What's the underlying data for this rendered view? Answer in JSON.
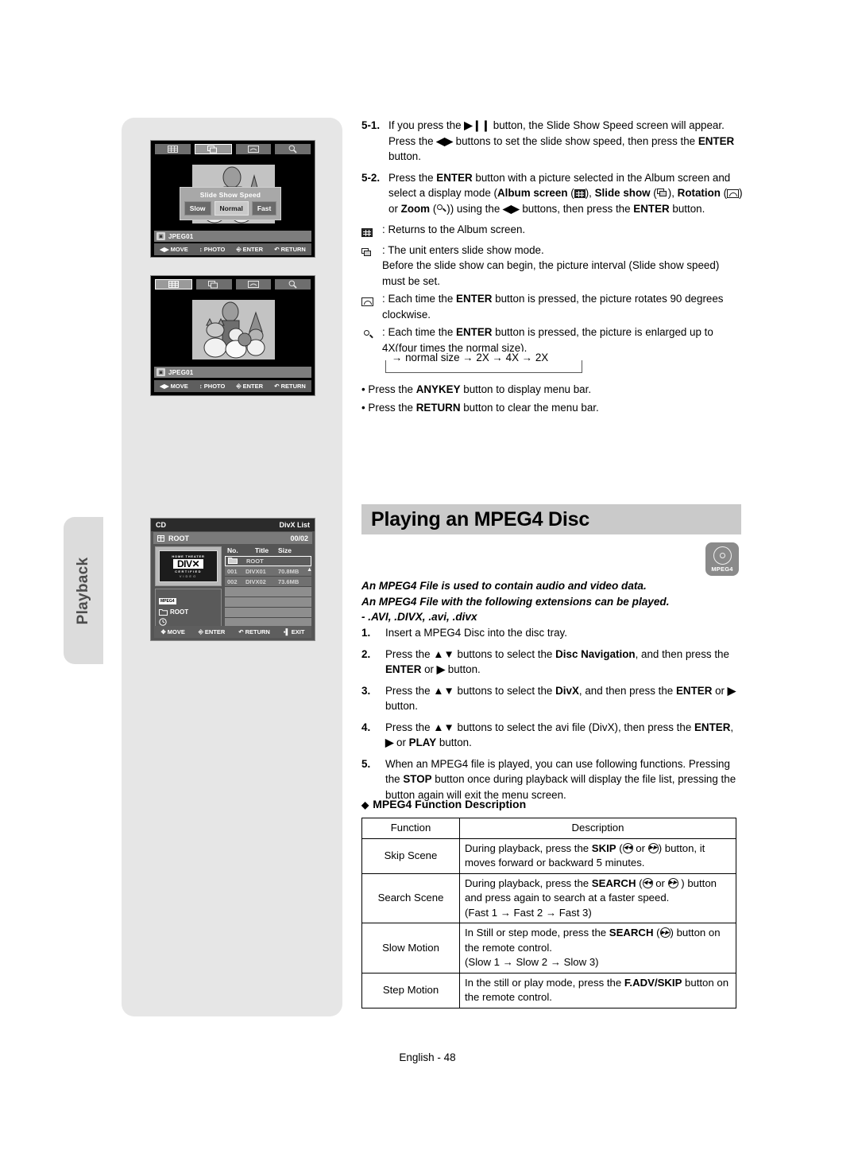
{
  "sidebar": {
    "tab_label": "Playback"
  },
  "screens": {
    "slideshow": {
      "toolbar": [
        "album-screen-icon",
        "slide-show-icon",
        "rotation-icon",
        "zoom-icon"
      ],
      "selected_tool": "slide-show-icon",
      "dialog": {
        "title": "Slide Show Speed",
        "options": [
          "Slow",
          "Normal",
          "Fast"
        ],
        "selected": "Normal"
      },
      "file_label": "JPEG01",
      "hints": [
        {
          "key": "◀▶",
          "label": "MOVE"
        },
        {
          "key": "↕",
          "label": "PHOTO"
        },
        {
          "key": "⓪",
          "label": "ENTER"
        },
        {
          "key": "↶",
          "label": "RETURN"
        }
      ]
    },
    "album": {
      "toolbar": [
        "album-screen-icon",
        "slide-show-icon",
        "rotation-icon",
        "zoom-icon"
      ],
      "selected_tool": "album-screen-icon",
      "file_label": "JPEG01",
      "hints": [
        {
          "key": "◀▶",
          "label": "MOVE"
        },
        {
          "key": "↕",
          "label": "PHOTO"
        },
        {
          "key": "⓪",
          "label": "ENTER"
        },
        {
          "key": "↶",
          "label": "RETURN"
        }
      ]
    },
    "divx_list": {
      "disc_label": "CD",
      "mode_label": "DivX List",
      "folder": "ROOT",
      "counter": "00/02",
      "logo": {
        "top_text": "HOME THEATER",
        "brand": "DIV✕",
        "certified": "CERTIFIED",
        "video": "VIDEO"
      },
      "tree": {
        "tag": "MPEG4",
        "root": "ROOT"
      },
      "columns": [
        "No.",
        "Title",
        "Size"
      ],
      "rows": [
        {
          "no": "",
          "title": "ROOT",
          "size": "",
          "selected": true,
          "folder": true
        },
        {
          "no": "001",
          "title": "DIVX01",
          "size": "70.8MB",
          "selected": false,
          "folder": false
        },
        {
          "no": "002",
          "title": "DIVX02",
          "size": "73.6MB",
          "selected": false,
          "folder": false
        }
      ],
      "empty_rows": 5,
      "hints": [
        {
          "key": "✥",
          "label": "MOVE"
        },
        {
          "key": "⓪",
          "label": "ENTER"
        },
        {
          "key": "↶",
          "label": "RETURN"
        },
        {
          "key": "▮",
          "label": "EXIT"
        }
      ]
    }
  },
  "steps_top": [
    {
      "num": "5-1.",
      "html": "If you press the <b>▶❙❙</b> button, the Slide Show Speed screen will appear. Press the <b>◀▶</b> buttons to set the slide show speed, then press the <b>ENTER</b> button."
    },
    {
      "num": "5-2.",
      "html": "Press the <b>ENTER</b> button with a picture selected in the Album screen and select a display mode (<b>Album screen</b> (ICON_GRID), <b>Slide show</b> (ICON_SLIDE), <b>Rotation</b> (ICON_ROT) or <b>Zoom</b> (ICON_MAG)) using the <b>◀▶</b> buttons, then press the <b>ENTER</b> button."
    }
  ],
  "icon_notes": [
    {
      "icon": "album-screen-icon",
      "html": ": Returns to the Album screen."
    },
    {
      "icon": "slide-show-icon",
      "html": ": The unit enters slide show mode.<br>Before the slide show can begin, the picture interval (Slide show speed) must be set."
    },
    {
      "icon": "rotation-icon",
      "html": ": Each time the <b>ENTER</b> button is pressed, the picture rotates 90 degrees clockwise."
    },
    {
      "icon": "zoom-icon",
      "html": ": Each time the <b>ENTER</b> button is pressed, the picture is enlarged up to 4X(four times the normal size)."
    }
  ],
  "zoom_flow": "→ normal size → 2X → 4X → 2X",
  "bullets": [
    "Press the <b>ANYKEY</b> button to display menu bar.",
    "Press the <b>RETURN</b> button to clear the menu bar."
  ],
  "section": {
    "title": "Playing an MPEG4 Disc",
    "badge": "MPEG4"
  },
  "intro_lines": [
    "An MPEG4 File is used to contain audio and video data.",
    "An MPEG4 File with the following extensions can be played.",
    "- .AVI, .DIVX, .avi, .divx"
  ],
  "mpeg4_steps": [
    {
      "num": "1.",
      "html": "Insert a MPEG4 Disc into the disc tray."
    },
    {
      "num": "2.",
      "html": "Press the <b>▲▼</b> buttons to select the <b>Disc Navigation</b>, and then press the <b>ENTER</b> or <b>▶</b> button."
    },
    {
      "num": "3.",
      "html": "Press the <b>▲▼</b> buttons to select the <b>DivX</b>, and then press the <b>ENTER</b> or <b>▶</b> button."
    },
    {
      "num": "4.",
      "html": "Press the <b>▲▼</b> buttons to select the avi file (DivX), then press the <b>ENTER</b>, <b>▶</b> or <b>PLAY</b> button."
    },
    {
      "num": "5.",
      "html": "When an MPEG4 file is played, you can use following functions. Pressing the <b>STOP</b> button once during playback will display the file list, pressing the button again will exit the menu screen."
    }
  ],
  "function_table": {
    "heading": "MPEG4 Function Description",
    "heading_marker": "◆",
    "columns": [
      "Function",
      "Description"
    ],
    "rows": [
      {
        "function": "Skip Scene",
        "description": "During playback, press the <b>SKIP</b> (BTN_PREV or BTN_NEXT) button, it moves forward or backward 5 minutes."
      },
      {
        "function": "Search Scene",
        "description": "During playback, press the <b>SEARCH</b> (BTN_PREV or BTN_NEXT ) button and press again to search at a faster speed.<br>(Fast 1 → Fast 2 → Fast 3)"
      },
      {
        "function": "Slow Motion",
        "description": "In Still or step mode, press the <b>SEARCH</b> (BTN_NEXT) button on the remote control.<br>(Slow 1 → Slow 2 → Slow 3)"
      },
      {
        "function": "Step Motion",
        "description": "In the still or play mode, press the <b>F.ADV/SKIP</b> button on the remote control."
      }
    ]
  },
  "footer": {
    "page_label": "English - 48"
  }
}
